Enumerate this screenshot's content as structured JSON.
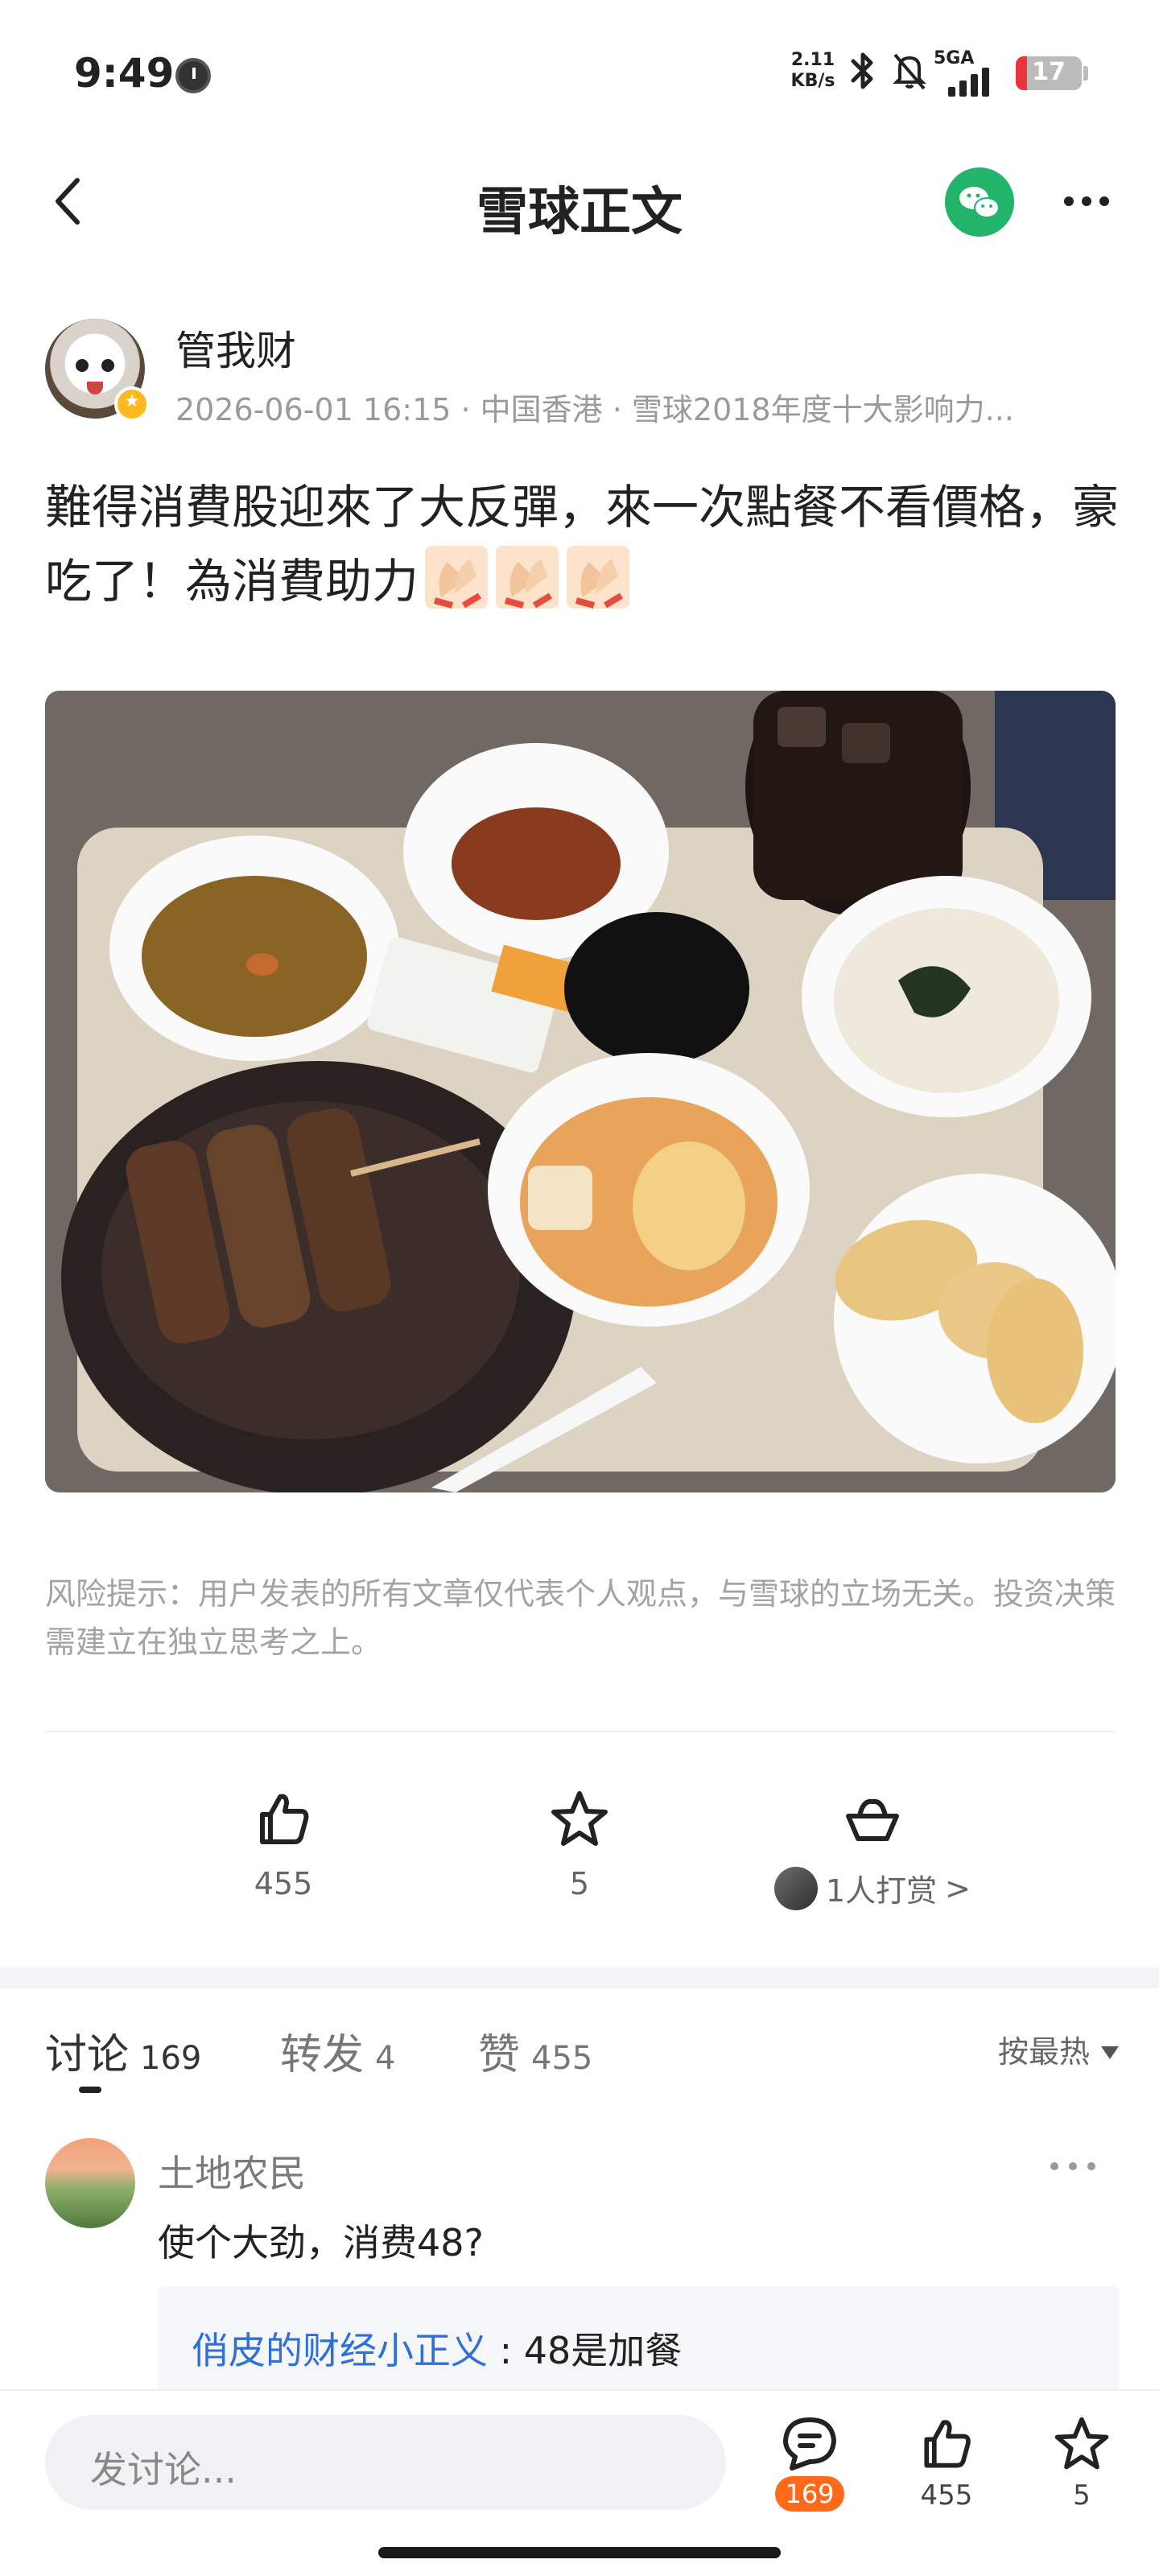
{
  "status_bar": {
    "time": "9:49",
    "net_speed_value": "2.11",
    "net_speed_unit": "KB/s",
    "network": "5GA",
    "battery": "17",
    "battery_level_percent": 17
  },
  "nav": {
    "title": "雪球正文",
    "icons": [
      "back-chevron-icon",
      "wechat-icon",
      "more-icon"
    ]
  },
  "author": {
    "name": "管我财",
    "meta": "2026-06-01 16:15 · 中国香港 · 雪球2018年度十大影响力..."
  },
  "post": {
    "text": "難得消費股迎來了大反彈，來一次點餐不看價格，豪吃了！為消費助力",
    "emoji": [
      "clapping-hands-emoji",
      "clapping-hands-emoji",
      "clapping-hands-emoji"
    ],
    "image": "food-tray-photo"
  },
  "risk_notice": "风险提示：用户发表的所有文章仅代表个人观点，与雪球的立场无关。投资决策需建立在独立思考之上。",
  "actions": {
    "like_count": "455",
    "favorite_count": "5",
    "reward_text": "1人打赏",
    "reward_chevron": ">"
  },
  "tabs": [
    {
      "label": "讨论",
      "count": "169"
    },
    {
      "label": "转发",
      "count": "4"
    },
    {
      "label": "赞",
      "count": "455"
    }
  ],
  "sort_label": "按最热",
  "comment": {
    "author": "土地农民",
    "text": "使个大劲，消费48?",
    "reply_author": "俏皮的财经小正义",
    "reply_separator": ":",
    "reply_text": "48是加餐"
  },
  "bottom_bar": {
    "input_placeholder": "发讨论...",
    "comment_count": "169",
    "like_count": "455",
    "favorite_count": "5"
  },
  "colors": {
    "wechat_green": "#22b46a",
    "link_blue": "#2f6fd8",
    "badge_orange": "#ff6a1a",
    "battery_red": "#e8343c"
  }
}
